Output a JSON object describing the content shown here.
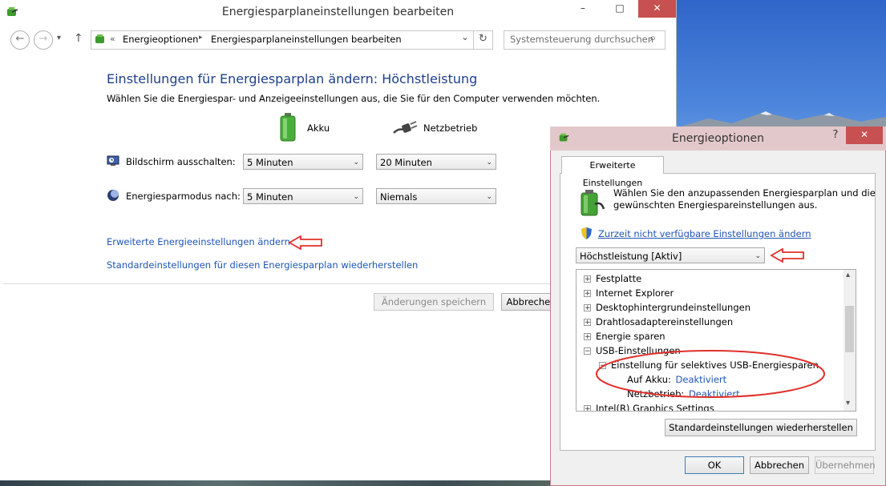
{
  "main_window": {
    "title": "Energiesparplaneinstellungen bearbeiten",
    "min_label": "–",
    "max_label": "□",
    "close_label": "✕",
    "nav": {
      "back": "←",
      "forward": "→",
      "recent": "▾",
      "up": "↑",
      "breadcrumb_sep": "«",
      "crumbs": [
        "Energieoptionen",
        "Energiesparplaneinstellungen bearbeiten"
      ],
      "crumb_arrow": "▸",
      "dropdown": "⌄",
      "refresh": "↻",
      "search_placeholder": "Systemsteuerung durchsuchen",
      "search_icon": "⌕"
    },
    "heading": "Einstellungen für Energiesparplan ändern: Höchstleistung",
    "subheading": "Wählen Sie die Energiespar- und Anzeigeeinstellungen aus, die Sie für den Computer verwenden möchten.",
    "columns": {
      "battery": "Akku",
      "plugged": "Netzbetrieb"
    },
    "rows": [
      {
        "label": "Bildschirm ausschalten:",
        "battery": "5 Minuten",
        "plugged": "20 Minuten"
      },
      {
        "label": "Energiesparmodus nach:",
        "battery": "5 Minuten",
        "plugged": "Niemals"
      }
    ],
    "link_advanced": "Erweiterte Energieeinstellungen ändern",
    "link_restore": "Standardeinstellungen für diesen Energiesparplan wiederherstellen",
    "btn_save": "Änderungen speichern",
    "btn_cancel": "Abbrechen",
    "select_arrow": "⌄"
  },
  "dialog": {
    "title": "Energieoptionen",
    "help": "?",
    "close": "✕",
    "tab": "Erweiterte Einstellungen",
    "intro_line1": "Wählen Sie den anzupassenden Energiesparplan und die",
    "intro_line2": "gewünschten Energiespareinstellungen aus.",
    "link_unavailable": "Zurzeit nicht verfügbare Einstellungen ändern",
    "plan_select": "Höchstleistung [Aktiv]",
    "tree": [
      {
        "label": "Festplatte",
        "exp": "+"
      },
      {
        "label": "Internet Explorer",
        "exp": "+"
      },
      {
        "label": "Desktophintergrundeinstellungen",
        "exp": "+"
      },
      {
        "label": "Drahtlosadaptereinstellungen",
        "exp": "+"
      },
      {
        "label": "Energie sparen",
        "exp": "+"
      },
      {
        "label": "USB-Einstellungen",
        "exp": "−"
      }
    ],
    "sub_item": {
      "label": "Einstellung für selektives USB-Energiesparen",
      "exp": "−"
    },
    "battery_label": "Auf Akku:",
    "battery_value": "Deaktiviert",
    "plugged_label": "Netzbetrieb:",
    "plugged_value": "Deaktiviert",
    "last_item": "Intel(R) Graphics Settings",
    "scroll_up": "▴",
    "scroll_down": "▾",
    "btn_restore": "Standardeinstellungen wiederherstellen",
    "btn_ok": "OK",
    "btn_cancel": "Abbrechen",
    "btn_apply": "Übernehmen"
  },
  "colors": {
    "link": "#1f55b5",
    "heading": "#1e3f8a",
    "annotation_red": "#e0302b",
    "close_red": "#c75050"
  }
}
